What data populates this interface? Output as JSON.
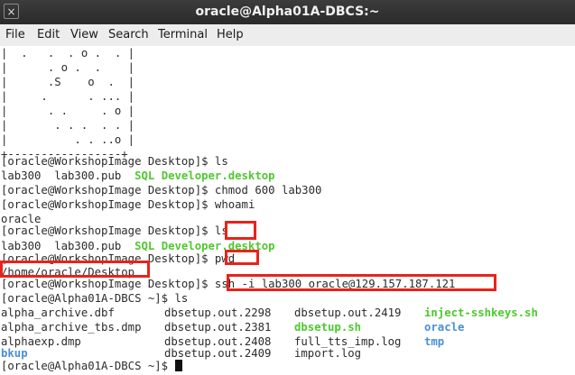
{
  "window": {
    "title": "oracle@Alpha01A-DBCS:~",
    "close_glyph": "×"
  },
  "menu": {
    "items": [
      "File",
      "Edit",
      "View",
      "Search",
      "Terminal",
      "Help"
    ]
  },
  "terminal": {
    "art": [
      "|  .   .  . o .  . |",
      "|      . o .  .    |",
      "|      .S    o  .  |",
      "|     .      . ... |",
      "|      . .     . o |",
      "|       . . .  . . |",
      "|          . . ..o |",
      "+-----------------+"
    ],
    "prompt_desktop": "[oracle@WorkshopImage Desktop]$ ",
    "prompt_remote": "[oracle@Alpha01A-DBCS ~]$ ",
    "commands": {
      "ls1": "ls",
      "chmod": "chmod 600 lab300",
      "whoami": "whoami",
      "ls2": "ls",
      "pwd": "pwd",
      "ssh": "ssh -i lab300 oracle@129.157.187.121",
      "ls3": "ls"
    },
    "desktop_files": {
      "plain": "lab300  lab300.pub  ",
      "exec": "SQL Developer.desktop"
    },
    "whoami_output": "oracle",
    "pwd_output": "/home/oracle/Desktop",
    "remote_ls": {
      "col1": [
        "alpha_archive.dbf",
        "alpha_archive_tbs.dmp",
        "alphaexp.dmp",
        "bkup"
      ],
      "col2": [
        "dbsetup.out.2298",
        "dbsetup.out.2381",
        "dbsetup.out.2408",
        "dbsetup.out.2409"
      ],
      "col3": [
        "dbsetup.out.2419",
        "dbsetup.sh",
        "full_tts_imp.log",
        "import.log"
      ],
      "col4": [
        "inject-sshkeys.sh",
        "oracle",
        "tmp"
      ]
    }
  },
  "colors": {
    "executable": "#4ec92e",
    "directory": "#4a8fd6",
    "highlight": "#e8231a"
  }
}
